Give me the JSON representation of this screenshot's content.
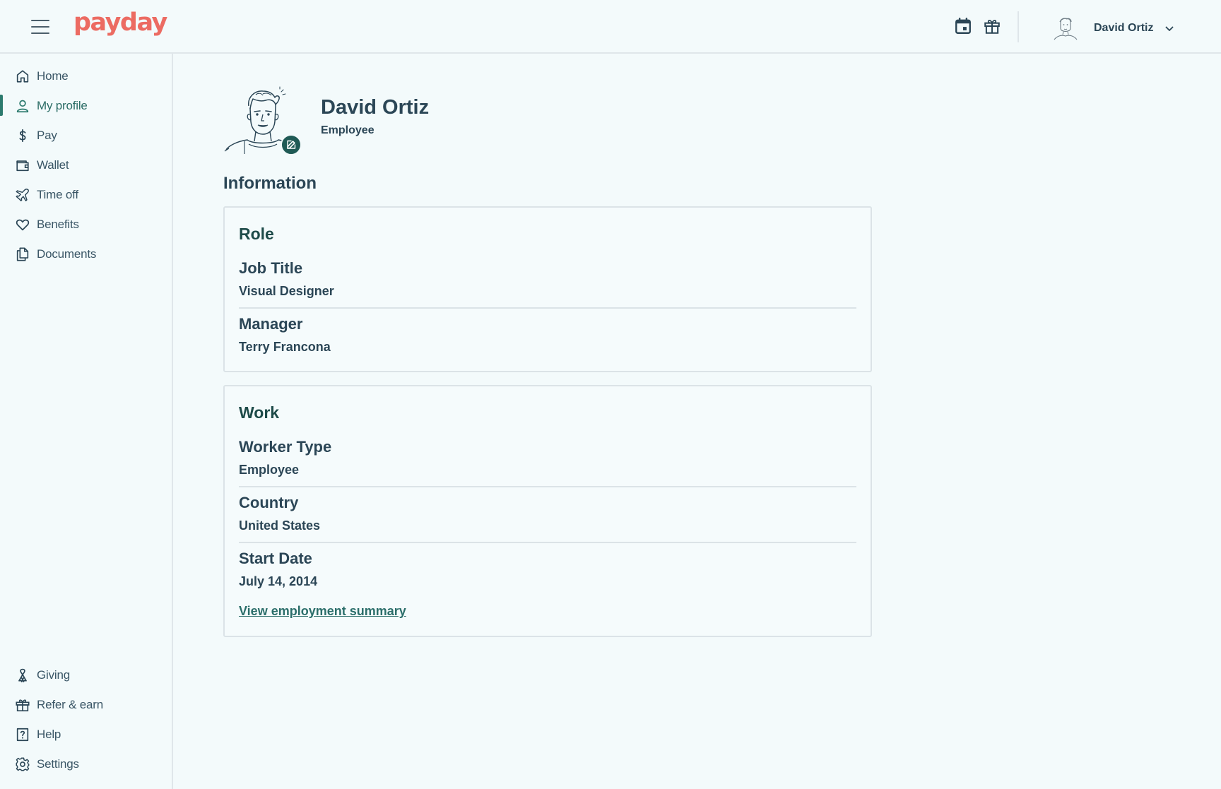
{
  "header": {
    "logo": "payday",
    "user_name": "David Ortiz",
    "icons": [
      "menu-icon",
      "calendar-icon",
      "gift-icon",
      "chevron-down-icon"
    ]
  },
  "sidebar": {
    "top_items": [
      {
        "label": "Home",
        "icon": "home-icon"
      },
      {
        "label": "My profile",
        "icon": "user-icon",
        "active": true
      },
      {
        "label": "Pay",
        "icon": "dollar-icon"
      },
      {
        "label": "Wallet",
        "icon": "wallet-icon"
      },
      {
        "label": "Time off",
        "icon": "plane-icon"
      },
      {
        "label": "Benefits",
        "icon": "heart-icon"
      },
      {
        "label": "Documents",
        "icon": "documents-icon"
      }
    ],
    "bottom_items": [
      {
        "label": "Giving",
        "icon": "ribbon-icon"
      },
      {
        "label": "Refer & earn",
        "icon": "gift-icon"
      },
      {
        "label": "Help",
        "icon": "help-icon"
      },
      {
        "label": "Settings",
        "icon": "gear-icon"
      }
    ]
  },
  "profile": {
    "name": "David Ortiz",
    "role": "Employee"
  },
  "information": {
    "title": "Information",
    "role_card": {
      "title": "Role",
      "fields": [
        {
          "label": "Job Title",
          "value": "Visual Designer"
        },
        {
          "label": "Manager",
          "value": "Terry Francona"
        }
      ]
    },
    "work_card": {
      "title": "Work",
      "fields": [
        {
          "label": "Worker Type",
          "value": "Employee"
        },
        {
          "label": "Country",
          "value": "United States"
        },
        {
          "label": "Start Date",
          "value": "July 14, 2014"
        }
      ],
      "link": "View employment summary"
    }
  },
  "colors": {
    "background": "#f3fafb",
    "brand": "#ec6b62",
    "accent": "#2c7a6e",
    "text": "#2b4656",
    "border": "#dbe3e7"
  }
}
